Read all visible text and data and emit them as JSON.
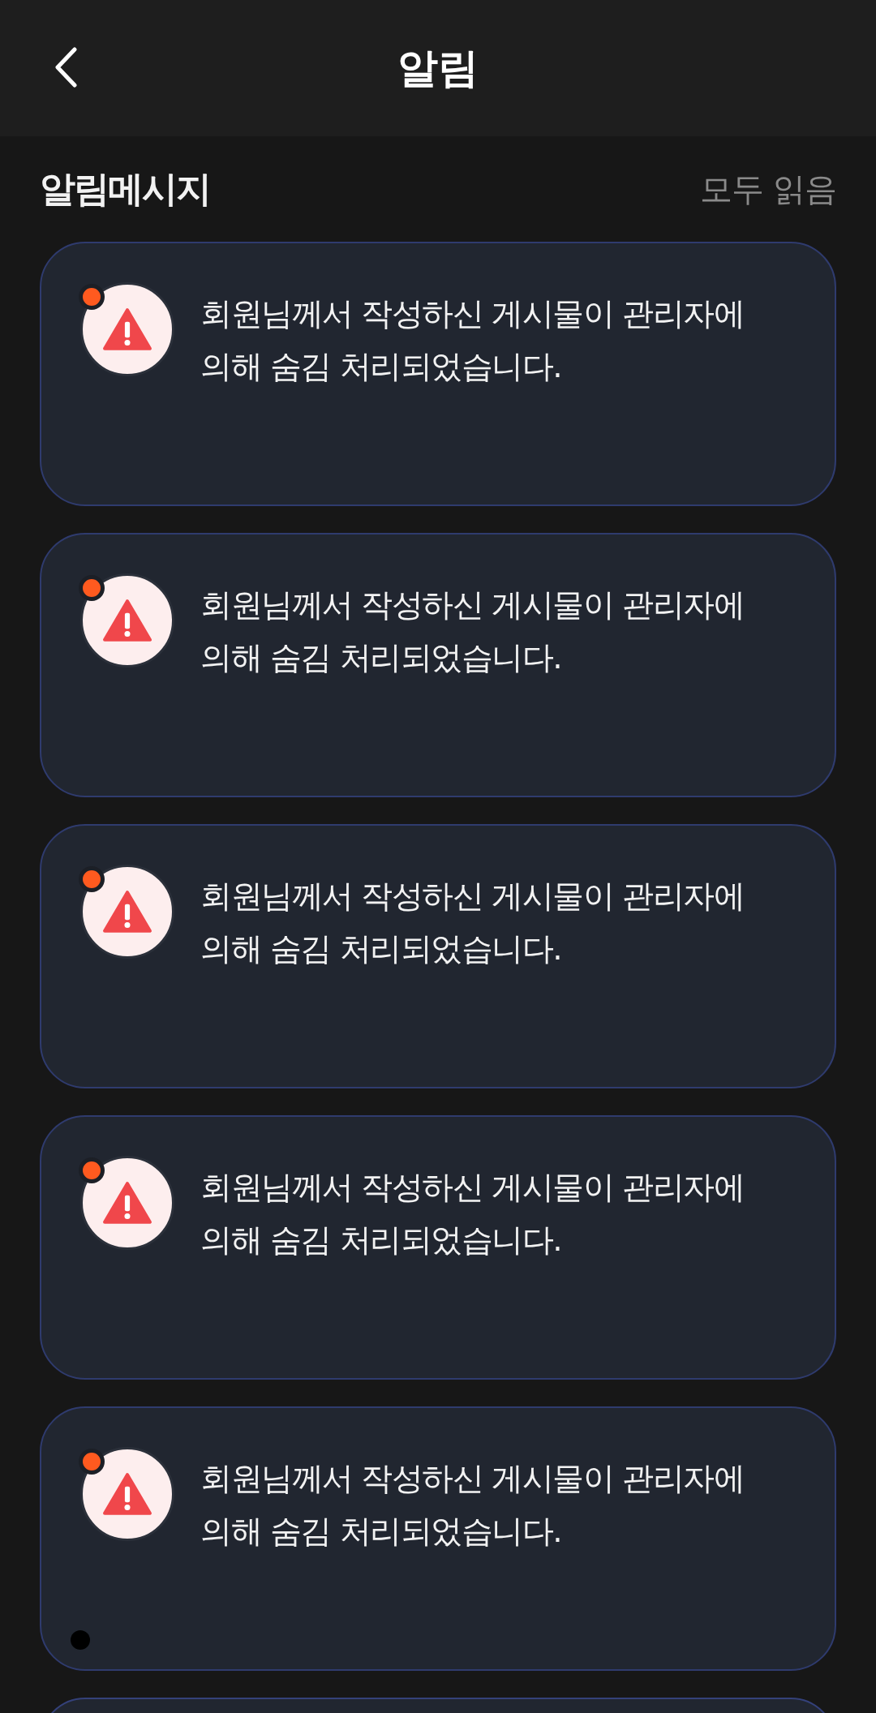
{
  "header": {
    "title": "알림"
  },
  "section": {
    "title": "알림메시지",
    "action": "모두 읽음"
  },
  "notifications": [
    {
      "kind": "message",
      "message": "회원님께서 작성하신 게시물이 관리자에 의해 숨김 처리되었습니다.",
      "unread": true,
      "touch_marker": false
    },
    {
      "kind": "message",
      "message": "회원님께서 작성하신 게시물이 관리자에 의해 숨김 처리되었습니다.",
      "unread": true,
      "touch_marker": false
    },
    {
      "kind": "message",
      "message": "회원님께서 작성하신 게시물이 관리자에 의해 숨김 처리되었습니다.",
      "unread": true,
      "touch_marker": false
    },
    {
      "kind": "message",
      "message": "회원님께서 작성하신 게시물이 관리자에 의해 숨김 처리되었습니다.",
      "unread": true,
      "touch_marker": false
    },
    {
      "kind": "message",
      "message": "회원님께서 작성하신 게시물이 관리자에 의해 숨김 처리되었습니다.",
      "unread": true,
      "touch_marker": true
    },
    {
      "kind": "cut_off"
    }
  ]
}
